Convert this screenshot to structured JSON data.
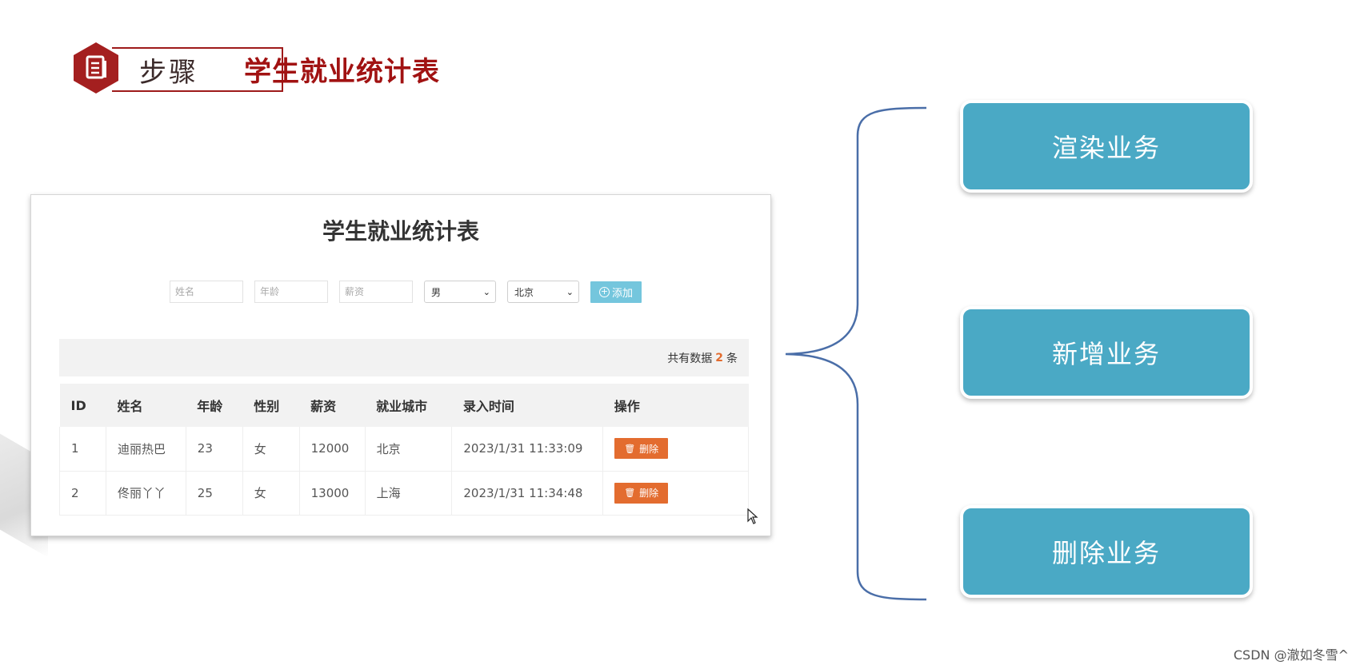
{
  "slide": {
    "step_label": "步骤",
    "title": "学生就业统计表"
  },
  "page": {
    "title": "学生就业统计表",
    "form": {
      "name_placeholder": "姓名",
      "age_placeholder": "年龄",
      "salary_placeholder": "薪资",
      "gender_selected": "男",
      "city_selected": "北京",
      "add_label": "添加"
    },
    "summary": {
      "prefix": "共有数据",
      "count": "2",
      "suffix": "条"
    },
    "table": {
      "headers": [
        "ID",
        "姓名",
        "年龄",
        "性别",
        "薪资",
        "就业城市",
        "录入时间",
        "操作"
      ],
      "rows": [
        {
          "id": "1",
          "name": "迪丽热巴",
          "age": "23",
          "gender": "女",
          "salary": "12000",
          "city": "北京",
          "time": "2023/1/31 11:33:09",
          "action": "删除"
        },
        {
          "id": "2",
          "name": "佟丽丫丫",
          "age": "25",
          "gender": "女",
          "salary": "13000",
          "city": "上海",
          "time": "2023/1/31 11:34:48",
          "action": "删除"
        }
      ]
    }
  },
  "business": [
    "渲染业务",
    "新增业务",
    "删除业务"
  ],
  "watermark": "CSDN @澈如冬雪^",
  "colors": {
    "accent_red": "#a11212",
    "add_button": "#74c6dd",
    "delete_button": "#e36c2f",
    "business_box": "#4aa9c5",
    "brace": "#4a6ea8"
  },
  "icons": [
    "document-icon",
    "plus-circle-icon",
    "trash-icon",
    "mouse-pointer-icon"
  ]
}
